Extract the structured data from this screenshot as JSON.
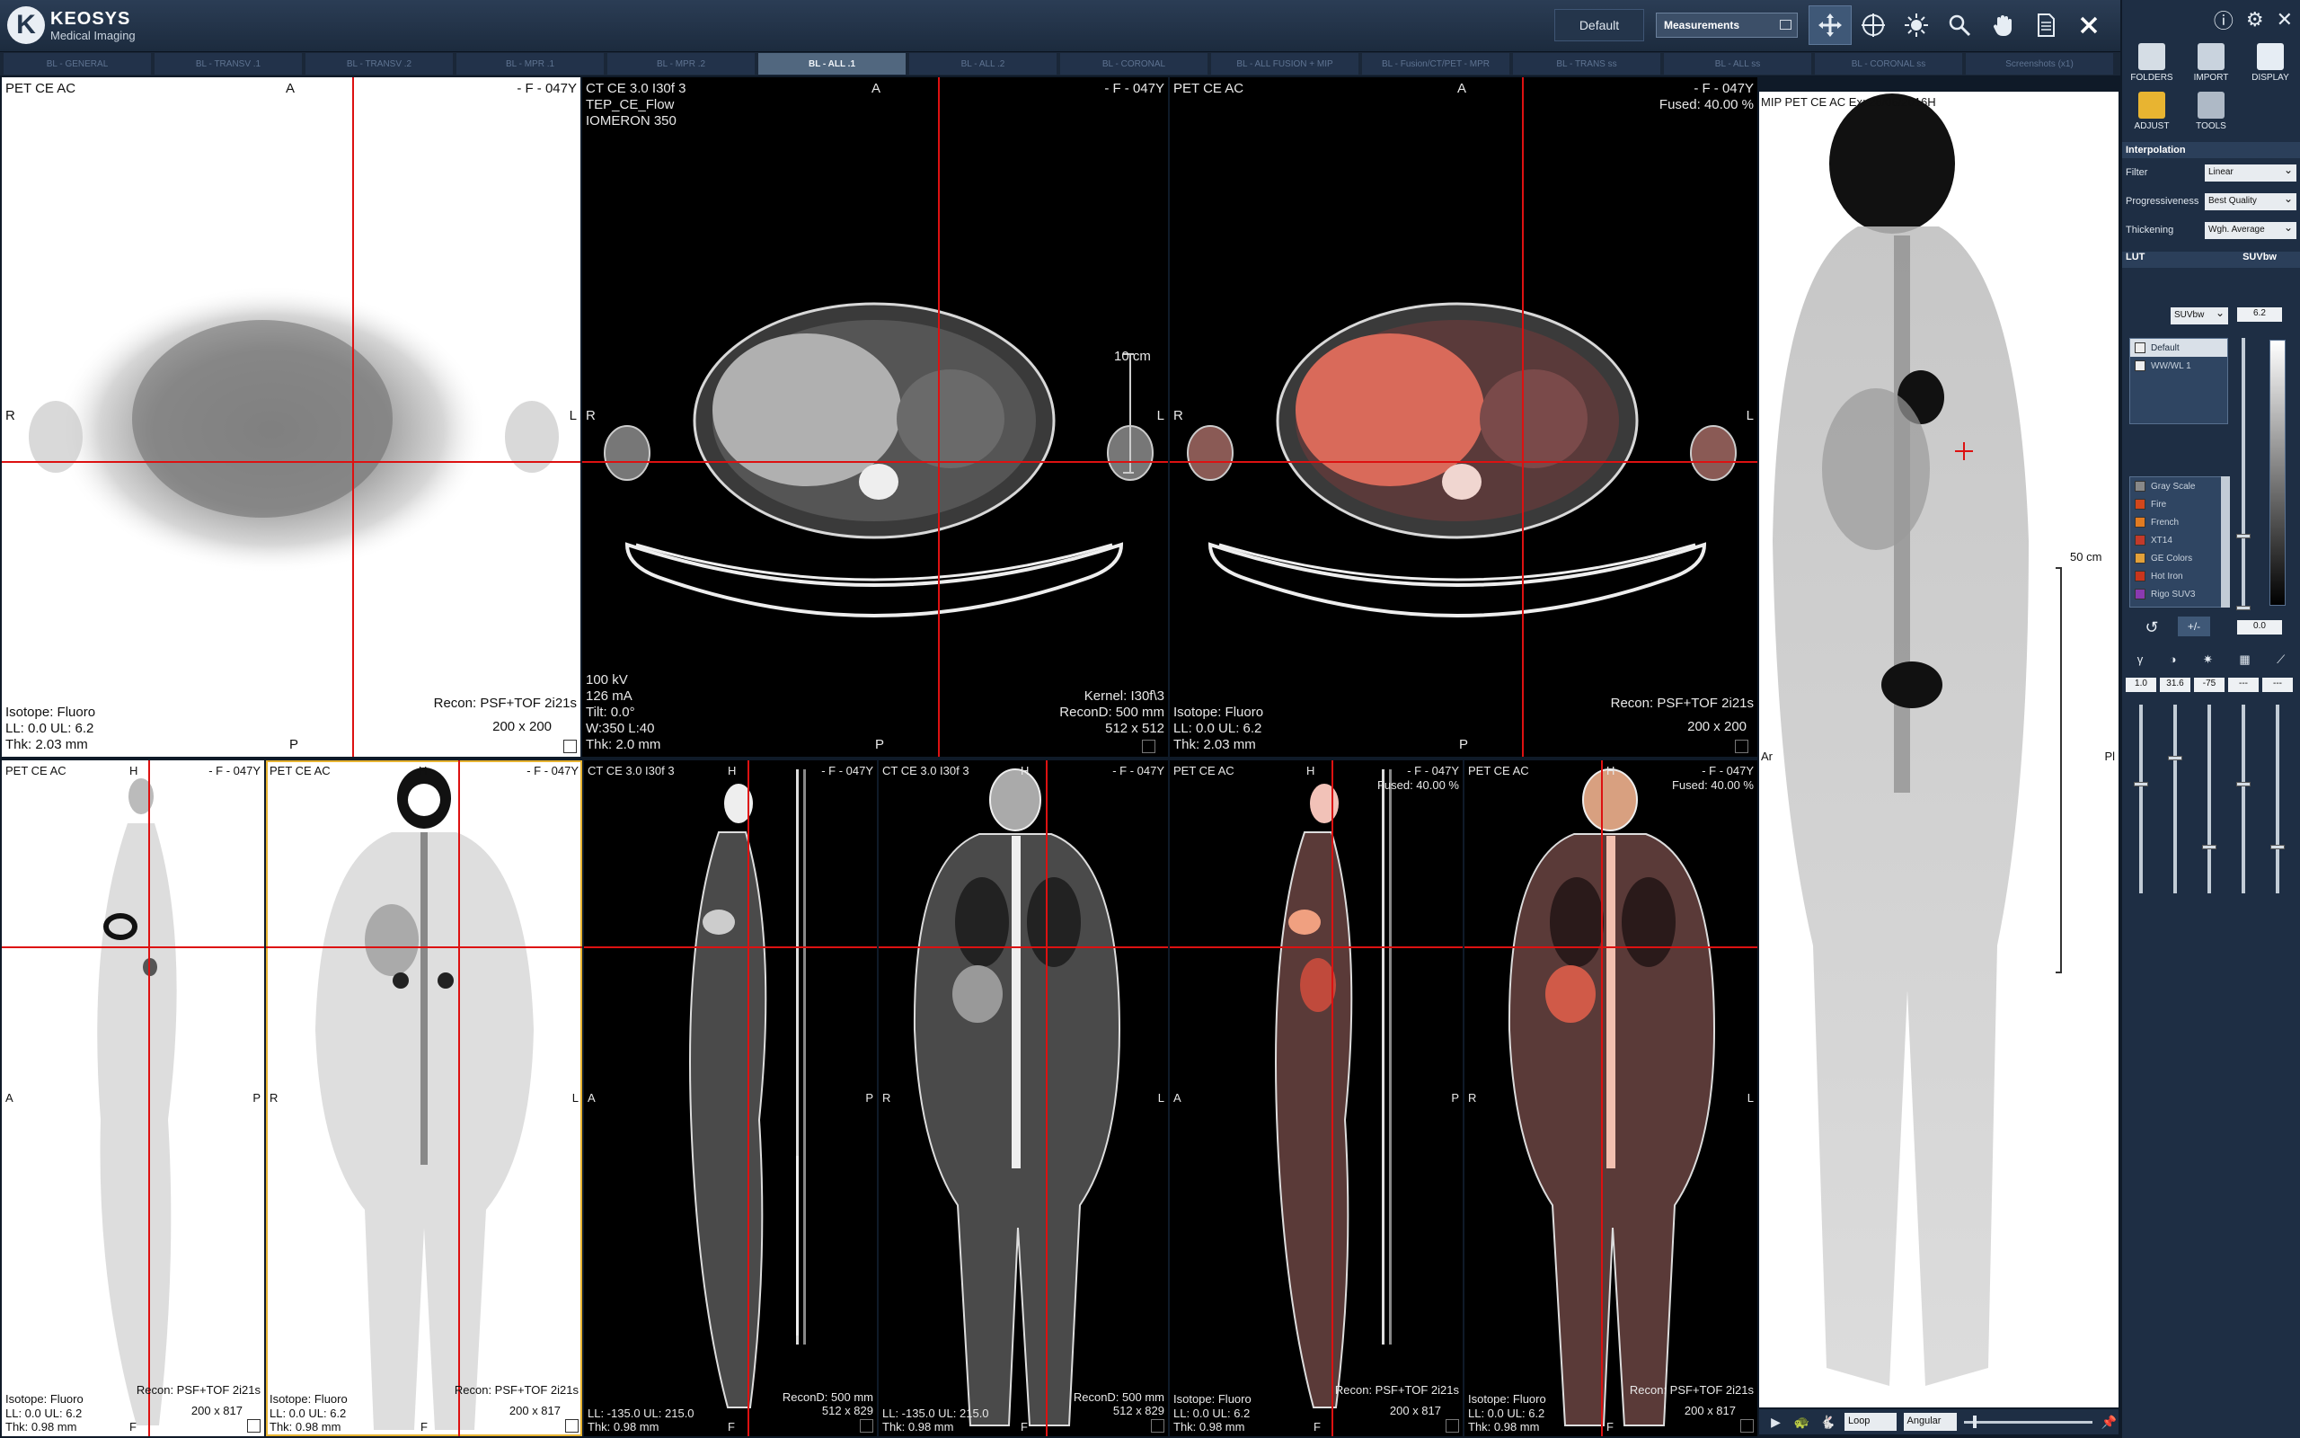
{
  "app": {
    "logo_letter": "K",
    "logo_name": "KEOSYS",
    "logo_sub": "Medical Imaging"
  },
  "topbar": {
    "layout_label": "Default",
    "measurements_label": "Measurements",
    "tools": [
      "move-arrows-icon",
      "crosshair-icon",
      "contrast-sun-icon",
      "zoom-icon",
      "pan-hand-icon",
      "report-icon",
      "close-icon",
      "pin-icon"
    ]
  },
  "tabs": [
    "BL - GENERAL",
    "BL - TRANSV .1",
    "BL - TRANSV .2",
    "BL - MPR .1",
    "BL - MPR .2",
    "BL - ALL .1",
    "BL - ALL .2",
    "BL - CORONAL",
    "BL - ALL FUSION + MIP",
    "BL - Fusion/CT/PET - MPR",
    "BL - TRANS ss",
    "BL - ALL ss",
    "BL - CORONAL ss",
    "Screenshots (x1)"
  ],
  "active_tab": 5,
  "views": {
    "pet_ax": {
      "tl": "PET CE AC",
      "top": "A",
      "tr": "- F - 047Y",
      "left": "R",
      "right": "L",
      "bottom": "P",
      "br1": "Recon: PSF+TOF 2i21s",
      "br2": "200 x 200",
      "bl1": "Isotope: Fluoro",
      "bl2": "LL: 0.0  UL: 6.2",
      "bl3": "Thk: 2.03 mm"
    },
    "ct_ax": {
      "tl1": "CT CE  3.0  I30f  3",
      "tl2": "TEP_CE_Flow",
      "tl3": "IOMERON 350",
      "top": "A",
      "tr": "- F - 047Y",
      "left": "R",
      "right": "L",
      "bottom": "P",
      "scale": "10 cm",
      "bl1": "100 kV",
      "bl2": "126 mA",
      "bl3": "Tilt: 0.0°",
      "bl4": "W:350  L:40",
      "bl5": "Thk: 2.0 mm",
      "br1": "Kernel: I30f\\3",
      "br2": "ReconD: 500 mm",
      "br3": "512 x 512"
    },
    "fus_ax": {
      "tl": "PET CE AC",
      "top": "A",
      "tr1": "- F - 047Y",
      "tr2": "Fused: 40.00 %",
      "left": "R",
      "right": "L",
      "bottom": "P",
      "bl1": "Isotope: Fluoro",
      "bl2": "LL: 0.0  UL: 6.2",
      "bl3": "Thk: 2.03 mm",
      "br1": "Recon: PSF+TOF 2i21s",
      "br2": "200 x 200"
    },
    "pet_sag": {
      "tl": "PET CE AC",
      "top": "H",
      "tr": "- F - 047Y",
      "left": "A",
      "right": "P",
      "bottom": "F",
      "bl1": "Isotope: Fluoro",
      "bl2": "LL: 0.0  UL: 6.2",
      "bl3": "Thk: 0.98 mm",
      "br1": "Recon: PSF+TOF 2i21s",
      "br2": "200 x 817"
    },
    "pet_cor": {
      "tl": "PET CE AC",
      "top": "H",
      "tr": "- F - 047Y",
      "left": "R",
      "right": "L",
      "bottom": "F",
      "bl1": "Isotope: Fluoro",
      "bl2": "LL: 0.0  UL: 6.2",
      "bl3": "Thk: 0.98 mm",
      "br1": "Recon: PSF+TOF 2i21s",
      "br2": "200 x 817"
    },
    "ct_sag": {
      "tl": "CT CE  3.0  I30f  3",
      "top": "H",
      "tr": "- F - 047Y",
      "left": "A",
      "right": "P",
      "bottom": "F",
      "bl1": "LL: -135.0  UL: 215.0",
      "bl2": "Thk: 0.98 mm",
      "br1": "ReconD: 500 mm",
      "br2": "512 x 829"
    },
    "ct_cor": {
      "tl": "CT CE  3.0  I30f  3",
      "top": "H",
      "tr": "- F - 047Y",
      "left": "R",
      "right": "L",
      "bottom": "F",
      "bl1": "LL: -135.0  UL: 215.0",
      "bl2": "Thk: 0.98 mm",
      "br1": "ReconD: 500 mm",
      "br2": "512 x 829"
    },
    "fus_sag": {
      "tl": "PET CE AC",
      "top": "H",
      "tr1": "- F - 047Y",
      "tr2": "Fused: 40.00 %",
      "left": "A",
      "right": "P",
      "bottom": "F",
      "bl1": "Isotope: Fluoro",
      "bl2": "LL: 0.0  UL: 6.2",
      "bl3": "Thk: 0.98 mm",
      "br1": "Recon: PSF+TOF 2i21s",
      "br2": "200 x 817"
    },
    "fus_cor": {
      "tl": "PET CE AC",
      "top": "H",
      "tr1": "- F - 047Y",
      "tr2": "Fused: 40.00 %",
      "left": "R",
      "right": "L",
      "bottom": "F",
      "bl1": "Isotope: Fluoro",
      "bl2": "LL: 0.0  UL: 6.2",
      "bl3": "Thk: 0.98 mm",
      "br1": "Recon: PSF+TOF 2i21s",
      "br2": "200 x 817"
    },
    "mip": {
      "tl": "MIP PET CE AC Ex: 28/06/2016H",
      "left": "Ar",
      "right": "Pl",
      "scale": "50 cm"
    }
  },
  "panel": {
    "buttons": [
      {
        "label": "FOLDERS",
        "icon": "folders-icon"
      },
      {
        "label": "IMPORT",
        "icon": "import-icon"
      },
      {
        "label": "DISPLAY",
        "icon": "display-icon"
      },
      {
        "label": "ADJUST",
        "icon": "adjust-palette-icon"
      },
      {
        "label": "TOOLS",
        "icon": "tools-icon"
      }
    ],
    "interp_title": "Interpolation",
    "filter_label": "Filter",
    "filter_value": "Linear",
    "prog_label": "Progressiveness",
    "prog_value": "Best Quality",
    "thick_label": "Thickening",
    "thick_value": "Wgh. Average",
    "lut_title": "LUT",
    "lut_unit": "SUVbw",
    "lut_unit_select": "SUVbw",
    "lut_max": "6.2",
    "lut_min": "0.0",
    "presets": [
      "Default",
      "WW/WL 1"
    ],
    "luts": [
      {
        "name": "Gray Scale",
        "color": "#888888"
      },
      {
        "name": "Fire",
        "color": "#d2471c"
      },
      {
        "name": "French",
        "color": "#e17b22"
      },
      {
        "name": "XT14",
        "color": "#c23a2a"
      },
      {
        "name": "GE Colors",
        "color": "#e2a13a"
      },
      {
        "name": "Hot Iron",
        "color": "#c8351c"
      },
      {
        "name": "Rigo SUV3",
        "color": "#8a3ab0"
      }
    ],
    "reset_label": "↺",
    "plusminus_label": "+/-",
    "vals": [
      "1.0",
      "31.6",
      "-75",
      "---",
      "---"
    ],
    "sliders": [
      0.42,
      0.28,
      0.76,
      0.42,
      0.76
    ],
    "play_mode": "Loop",
    "rot_mode": "Angular"
  }
}
